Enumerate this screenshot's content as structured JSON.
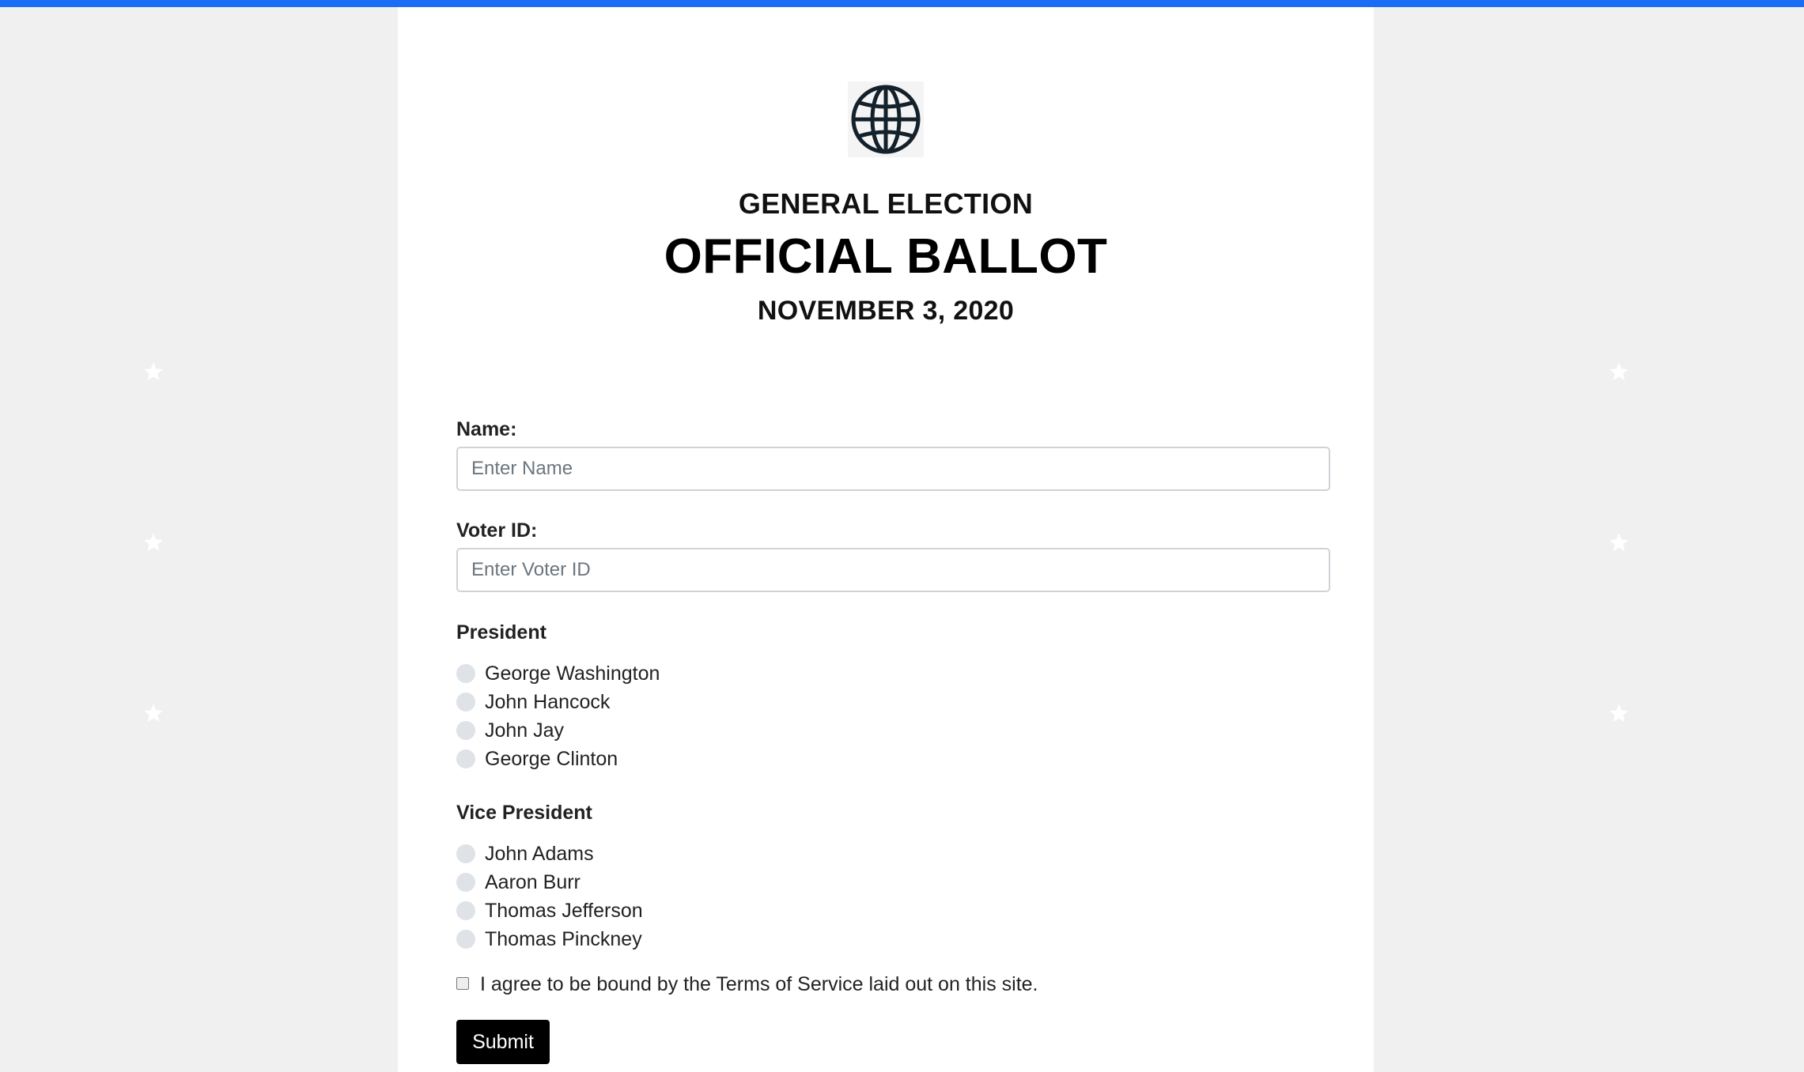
{
  "ballot": {
    "logo_icon": "globe-icon",
    "heading_sub": "GENERAL ELECTION",
    "heading_main": "OFFICIAL BALLOT",
    "date": "NOVEMBER 3, 2020"
  },
  "form": {
    "name_label": "Name:",
    "name_placeholder": "Enter Name",
    "voter_id_label": "Voter ID:",
    "voter_id_placeholder": "Enter Voter ID",
    "president": {
      "title": "President",
      "options": [
        "George Washington",
        "John Hancock",
        "John Jay",
        "George Clinton"
      ]
    },
    "vice_president": {
      "title": "Vice President",
      "options": [
        "John Adams",
        "Aaron Burr",
        "Thomas Jefferson",
        "Thomas Pinckney"
      ]
    },
    "terms_label": "I agree to be bound by the Terms of Service laid out on this site.",
    "submit_label": "Submit"
  },
  "colors": {
    "top_bar": "#1a6ef5",
    "background": "#f0f0f0",
    "card": "#ffffff",
    "button": "#000000"
  },
  "decor": {
    "star_icon": "star-icon"
  }
}
